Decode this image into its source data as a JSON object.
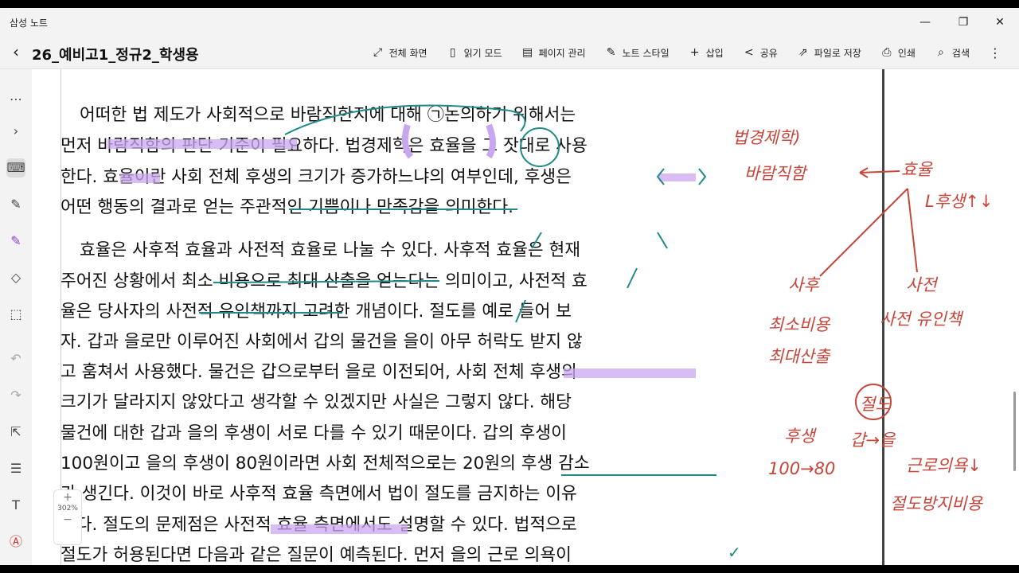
{
  "app": {
    "title": "삼성 노트"
  },
  "window_controls": {
    "minimize": "—",
    "maximize": "❐",
    "close": "✕"
  },
  "document": {
    "title": "26_예비고1_정규2_학생용"
  },
  "toolbar": {
    "items": [
      {
        "label": "전체 화면",
        "icon": "fullscreen-icon",
        "glyph": "⤢"
      },
      {
        "label": "읽기 모드",
        "icon": "book-icon",
        "glyph": "▯"
      },
      {
        "label": "페이지 관리",
        "icon": "page-icon",
        "glyph": "▤"
      },
      {
        "label": "노트 스타일",
        "icon": "style-icon",
        "glyph": "✎"
      },
      {
        "label": "삽입",
        "icon": "plus-icon",
        "glyph": "+"
      },
      {
        "label": "공유",
        "icon": "share-icon",
        "glyph": "<"
      },
      {
        "label": "파일로 저장",
        "icon": "export-icon",
        "glyph": "⇗"
      },
      {
        "label": "인쇄",
        "icon": "print-icon",
        "glyph": "⎙"
      },
      {
        "label": "검색",
        "icon": "search-icon",
        "glyph": "⌕"
      }
    ],
    "more_glyph": "⋮"
  },
  "zoom": {
    "level": "302%",
    "plus": "+",
    "minus": "−"
  },
  "text_lines": [
    {
      "text": "어떠한 법 제도가 사회적으로 바람직한지에 대해 ㉠논의하기 위해서는",
      "indent": true
    },
    {
      "text": "먼저 바람직함의 판단 기준이 필요하다. 법경제학은 효율을 그 잣대로 사용",
      "indent": false
    },
    {
      "text": "한다. 효율이란 사회 전체 후생의 크기가 증가하느냐의 여부인데, 후생은",
      "indent": false
    },
    {
      "text": "어떤 행동의 결과로 얻는 주관적인 기쁨이나 만족감을 의미한다.",
      "indent": false,
      "last": true
    },
    {
      "text": "효율은 사후적 효율과 사전적 효율로 나눌 수 있다. 사후적 효율은 현재",
      "indent": true
    },
    {
      "text": "주어진 상황에서 최소 비용으로 최대 산출을 얻는다는 의미이고, 사전적 효",
      "indent": false
    },
    {
      "text": "율은 당사자의 사전적 유인책까지 고려한 개념이다. 절도를 예로 들어 보",
      "indent": false
    },
    {
      "text": "자. 갑과 을로만 이루어진 사회에서 갑의 물건을 을이 아무 허락도 받지 않",
      "indent": false
    },
    {
      "text": "고 훔쳐서 사용했다. 물건은 갑으로부터 을로 이전되어, 사회 전체 후생의",
      "indent": false
    },
    {
      "text": "크기가 달라지지 않았다고 생각할 수 있겠지만 사실은 그렇지 않다. 해당",
      "indent": false
    },
    {
      "text": "물건에 대한 갑과 을의 후생이 서로 다를 수 있기 때문이다. 갑의 후생이",
      "indent": false
    },
    {
      "text": "100원이고 을의 후생이 80원이라면 사회 전체적으로는 20원의 후생 감소",
      "indent": false
    },
    {
      "text": "가 생긴다. 이것이 바로 사후적 효율 측면에서 법이 절도를 금지하는 이유",
      "indent": false
    },
    {
      "text": "이다. 절도의 문제점은 사전적 효율 측면에서도 설명할 수 있다. 법적으로",
      "indent": false
    },
    {
      "text": "절도가 허용된다면 다음과 같은 질문이 예측된다. 먼저 을의 근로 의욕이",
      "indent": false
    }
  ],
  "handwritten_notes": [
    {
      "id": "law-econ",
      "text": "법경제학)"
    },
    {
      "id": "desirability",
      "text": "바람직함"
    },
    {
      "id": "efficiency",
      "text": "효율"
    },
    {
      "id": "welfare",
      "text": "L후생↑↓"
    },
    {
      "id": "ex-post",
      "text": "사후"
    },
    {
      "id": "min-cost",
      "text": "최소비용"
    },
    {
      "id": "max-output",
      "text": "최대산출"
    },
    {
      "id": "ex-ante",
      "text": "사전"
    },
    {
      "id": "incentive",
      "text": "사전 유인책"
    },
    {
      "id": "theft",
      "text": "절도"
    },
    {
      "id": "welfare-2",
      "text": "후생"
    },
    {
      "id": "gap-eul",
      "text": "갑→을"
    },
    {
      "id": "values",
      "text": "100→80"
    },
    {
      "id": "work-will",
      "text": "근로의욕↓"
    },
    {
      "id": "theft-prevention",
      "text": "절도방지비용"
    }
  ],
  "colors": {
    "highlight_purple": "#c9a7f0",
    "pen_teal": "#1f8a86",
    "pen_red": "#c8453a"
  }
}
